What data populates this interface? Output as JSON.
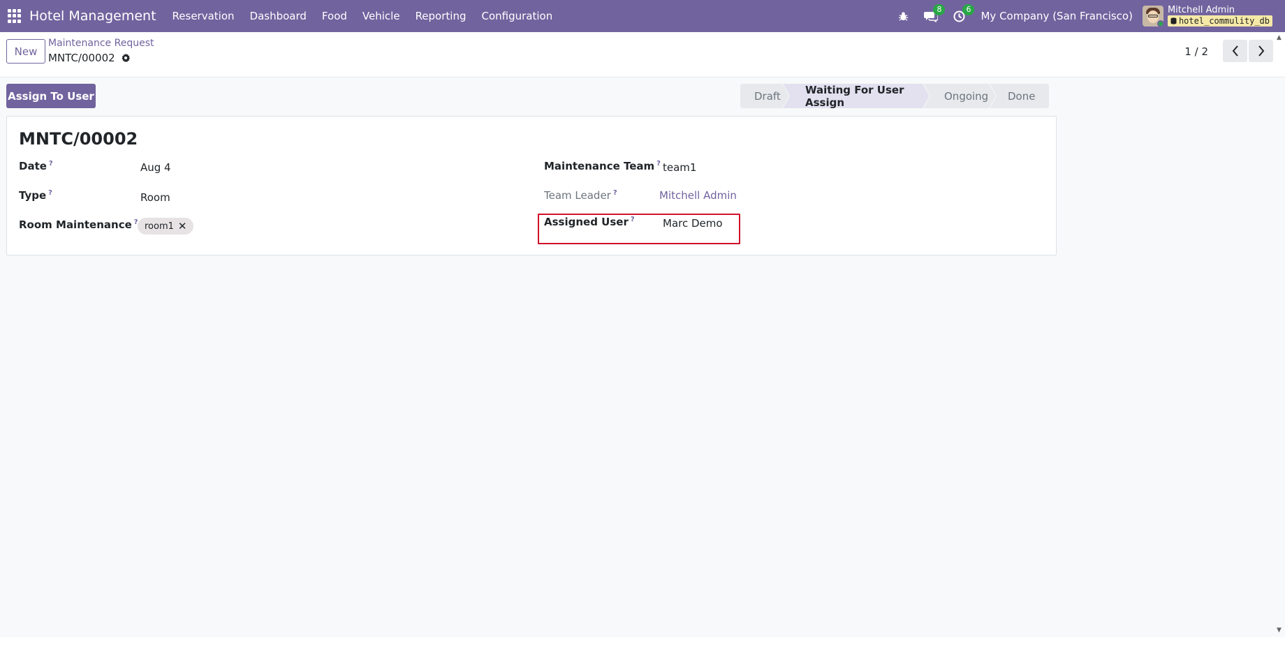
{
  "navbar": {
    "brand": "Hotel Management",
    "menu": [
      "Reservation",
      "Dashboard",
      "Food",
      "Vehicle",
      "Reporting",
      "Configuration"
    ],
    "messages_count": "8",
    "activities_count": "6",
    "company": "My Company (San Francisco)",
    "user_name": "Mitchell Admin",
    "database": "hotel_commulity_db"
  },
  "control": {
    "new_label": "New",
    "breadcrumb": "Maintenance Request",
    "record_name": "MNTC/00002",
    "pager": "1 / 2"
  },
  "actions": {
    "assign_label": "Assign To User"
  },
  "statusbar": {
    "stages": [
      "Draft",
      "Waiting For User Assign",
      "Ongoing",
      "Done"
    ],
    "active": "Waiting For User Assign"
  },
  "form": {
    "title": "MNTC/00002",
    "date_label": "Date",
    "date_value": "Aug 4",
    "type_label": "Type",
    "type_value": "Room",
    "room_label": "Room Maintenance",
    "room_tag": "room1",
    "team_label": "Maintenance Team",
    "team_value": "team1",
    "leader_label": "Team Leader",
    "leader_value": "Mitchell Admin",
    "assigned_label": "Assigned User",
    "assigned_value": "Marc Demo",
    "help_mark": "?"
  },
  "colors": {
    "brand": "#71639e",
    "highlight": "#d0102a",
    "badge": "#28a745"
  }
}
